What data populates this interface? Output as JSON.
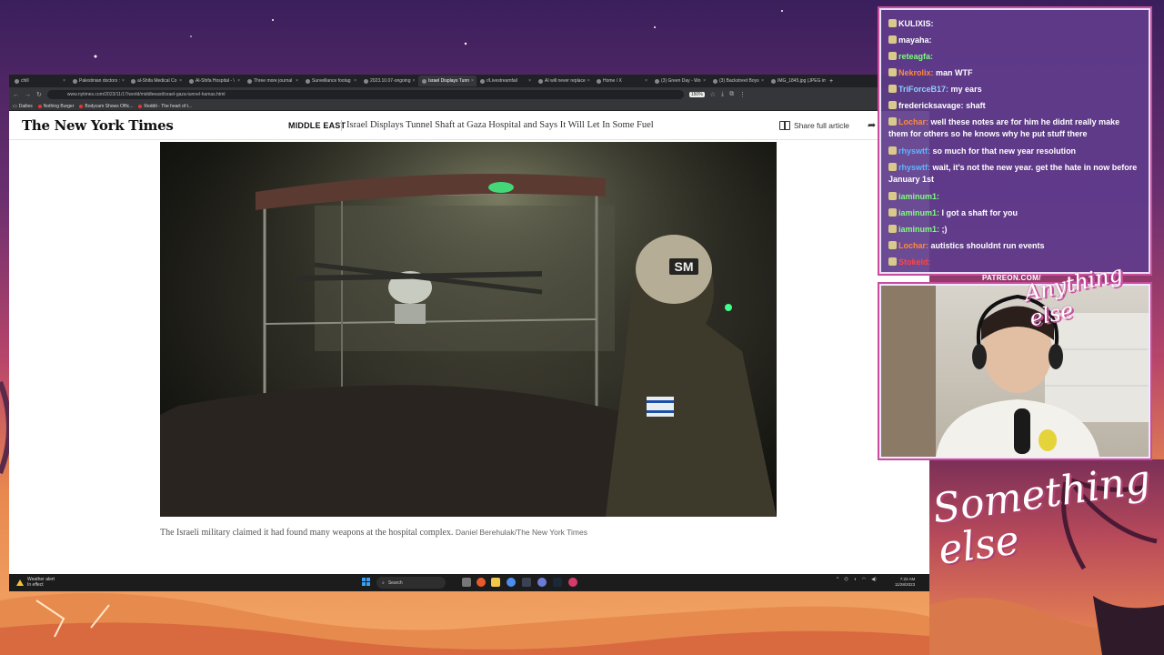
{
  "browser": {
    "tabs": [
      {
        "label": "chill",
        "active": false
      },
      {
        "label": "Palestinian doctors :",
        "active": false
      },
      {
        "label": "al-Shifa Medical Co",
        "active": false
      },
      {
        "label": "Al-Shifa Hospital - \\",
        "active": false
      },
      {
        "label": "Three more journal",
        "active": false
      },
      {
        "label": "Surveillance footag",
        "active": false
      },
      {
        "label": "2023.10.07-ongoing",
        "active": false
      },
      {
        "label": "Israel Displays Tunn",
        "active": true
      },
      {
        "label": "r/Livestreamfail",
        "active": false
      },
      {
        "label": "AI will never replace",
        "active": false
      },
      {
        "label": "Home / X",
        "active": false
      },
      {
        "label": "(3) Green Day - Wo",
        "active": false
      },
      {
        "label": "(3) Backstreet Boys",
        "active": false
      },
      {
        "label": "IMG_1845.jpg (JPEG im",
        "active": false
      }
    ],
    "url": "www.nytimes.com/2023/11/17/world/middleeast/israel-gaza-tunnel-hamas.html",
    "zoom": "150%",
    "bookmarks": [
      "Dailies",
      "Nothing Burger",
      "Bodycam Shows Offic...",
      "Reddit - The heart of t..."
    ]
  },
  "article": {
    "logo": "The New York Times",
    "section": "MIDDLE EAST",
    "headline": "Israel Displays Tunnel Shaft at Gaza Hospital and Says It Will Let In Some Fuel",
    "share_label": "Share full article",
    "caption": "The Israeli military claimed it had found many weapons at the hospital complex.",
    "credit": "Daniel Berehulak/The New York Times",
    "helmet_patch": "SM"
  },
  "taskbar": {
    "weather_line1": "Weather alert",
    "weather_line2": "In effect",
    "search_label": "Search",
    "time": "7:22 AM",
    "date": "11/28/2023"
  },
  "chat": {
    "messages": [
      {
        "user": "KULIXIS:",
        "text": "",
        "color": "#ffffff"
      },
      {
        "user": "mayaha:",
        "text": "",
        "color": "#ffffff"
      },
      {
        "user": "reteagfa:",
        "text": "",
        "color": "#7dff7a"
      },
      {
        "user": "Nekrolix:",
        "text": "man WTF",
        "color": "#ff8a3d"
      },
      {
        "user": "TriForceB17:",
        "text": "my ears",
        "color": "#8fd0ff"
      },
      {
        "user": "fredericksavage:",
        "text": "shaft",
        "color": "#ffffff"
      },
      {
        "user": "Lochar:",
        "text": "well these notes are for him he didnt really make them for others so he knows why he put stuff there",
        "color": "#ff8a3d"
      },
      {
        "user": "rhyswtf:",
        "text": "so much for that new year resolution",
        "color": "#5ab8ff"
      },
      {
        "user": "rhyswtf:",
        "text": "wait, it's not the new year. get the hate in now before January 1st",
        "color": "#5ab8ff"
      },
      {
        "user": "iaminum1:",
        "text": "",
        "color": "#7dff7a"
      },
      {
        "user": "iaminum1:",
        "text": "I got a shaft for you",
        "color": "#7dff7a"
      },
      {
        "user": "iaminum1:",
        "text": ";)",
        "color": "#7dff7a"
      },
      {
        "user": "Lochar:",
        "text": "autistics shouldnt run events",
        "color": "#ff8a3d"
      },
      {
        "user": "Stokeld:",
        "text": "",
        "color": "#ff4444"
      }
    ]
  },
  "overlay": {
    "patreon": "PATREON.COM/",
    "anything": "Anything else",
    "something": "Something else"
  }
}
